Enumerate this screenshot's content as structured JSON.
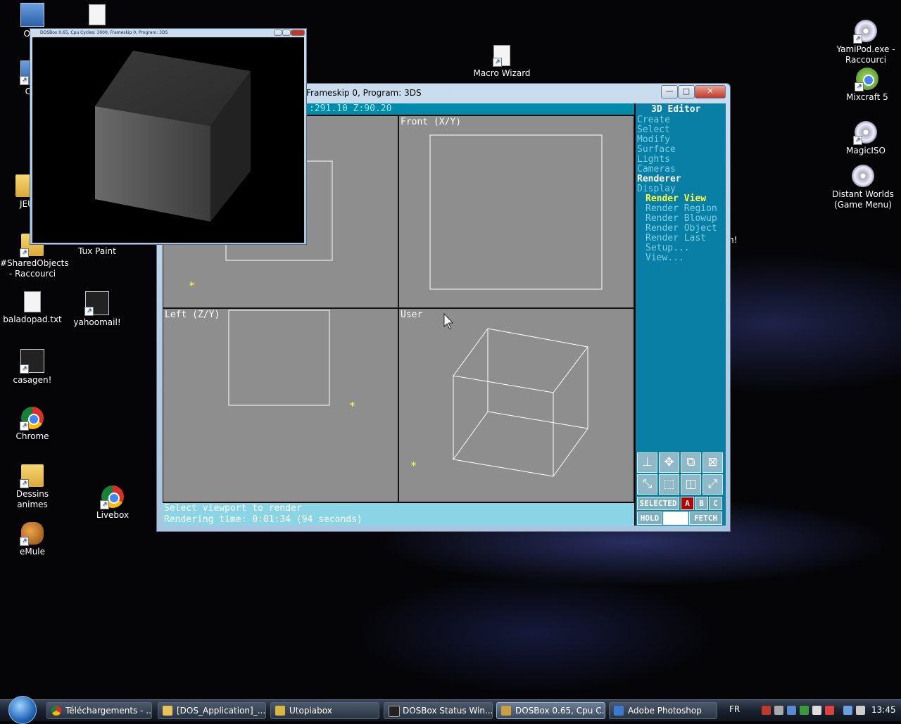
{
  "desktop": {
    "icons": [
      {
        "label": "Ordi",
        "icon": "computer-icon"
      },
      {
        "label": "",
        "icon": "text-file-icon"
      },
      {
        "label": "Cor",
        "icon": "shortcut-icon"
      },
      {
        "label": "JEU",
        "icon": "folder-icon"
      },
      {
        "label": "#SharedObjects - Raccourci",
        "icon": "folder-shortcut-icon"
      },
      {
        "label": "Tux Paint",
        "icon": "tux-paint-icon"
      },
      {
        "label": "baladopad.txt",
        "icon": "text-file-icon"
      },
      {
        "label": "yahoomail!",
        "icon": "yahoomail-icon"
      },
      {
        "label": "casagen!",
        "icon": "casagen-icon"
      },
      {
        "label": "Chrome",
        "icon": "chrome-icon"
      },
      {
        "label": "Dessins animes",
        "icon": "folder-shortcut-icon"
      },
      {
        "label": "Livebox",
        "icon": "chrome-icon"
      },
      {
        "label": "eMule",
        "icon": "emule-icon"
      },
      {
        "label": "Macro Wizard",
        "icon": "macro-wizard-icon"
      },
      {
        "label": "YamiPod.exe - Raccourci",
        "icon": "yamipod-icon"
      },
      {
        "label": "Mixcraft 5",
        "icon": "mixcraft-icon"
      },
      {
        "label": "MagicISO",
        "icon": "magiciso-icon"
      },
      {
        "label": "Distant Worlds (Game Menu)",
        "icon": "distant-worlds-icon"
      },
      {
        "label": "gen!",
        "icon": "casagen-icon"
      }
    ]
  },
  "dosbox_window": {
    "title": "Frameskip  0, Program:     3DS",
    "buttons": {
      "minimize": "—",
      "maximize": "□",
      "close": "✕"
    }
  },
  "editor": {
    "coords": ":291.10   Z:90.20",
    "panel_title": "3D Editor",
    "menu": [
      "Create",
      "Select",
      "Modify",
      "Surface",
      "Lights",
      "Cameras",
      "Renderer",
      "Display"
    ],
    "active_menu": "Renderer",
    "submenu": [
      "Render View",
      "Render Region",
      "Render Blowup",
      "Render Object",
      "Render Last",
      "Setup...",
      "View..."
    ],
    "highlighted_submenu": "Render View",
    "viewports": {
      "top_left": "",
      "front": "Front (X/Y)",
      "left": "Left (Z/Y)",
      "user": "User"
    },
    "selection": {
      "selected": "SELECTED",
      "a": "A",
      "b": "B",
      "c": "C",
      "hold": "HOLD",
      "fetch": "FETCH"
    },
    "status_line_1": "Select viewport to render",
    "status_line_2": "Rendering time: 0:01:34 (94 seconds)"
  },
  "render_window": {
    "title": "DOSBox 0.65, Cpu Cycles:    3000, Frameskip  0, Program:    3DS"
  },
  "taskbar": {
    "tasks": [
      {
        "label": "Téléchargements - ...",
        "icon": "chrome-icon",
        "color": "#e04a3a"
      },
      {
        "label": "[DOS_Application]_...",
        "icon": "folder-icon",
        "color": "#e8c25a"
      },
      {
        "label": "Utopiabox",
        "icon": "utopiabox-icon",
        "color": "#d9b640"
      },
      {
        "label": "DOSBox Status Win...",
        "icon": "console-icon",
        "color": "#222222"
      },
      {
        "label": "DOSBox 0.65, Cpu C...",
        "icon": "dosbox-icon",
        "color": "#c8a040"
      },
      {
        "label": "Adobe Photoshop",
        "icon": "photoshop-icon",
        "color": "#3a7ad0"
      }
    ],
    "language": "FR",
    "clock": "13:45"
  },
  "colors": {
    "dos_cyan": "#0a7fa6",
    "highlight_yellow": "#ffff40",
    "selected_red": "#b00000",
    "viewport_gray": "#8e8e8e"
  }
}
